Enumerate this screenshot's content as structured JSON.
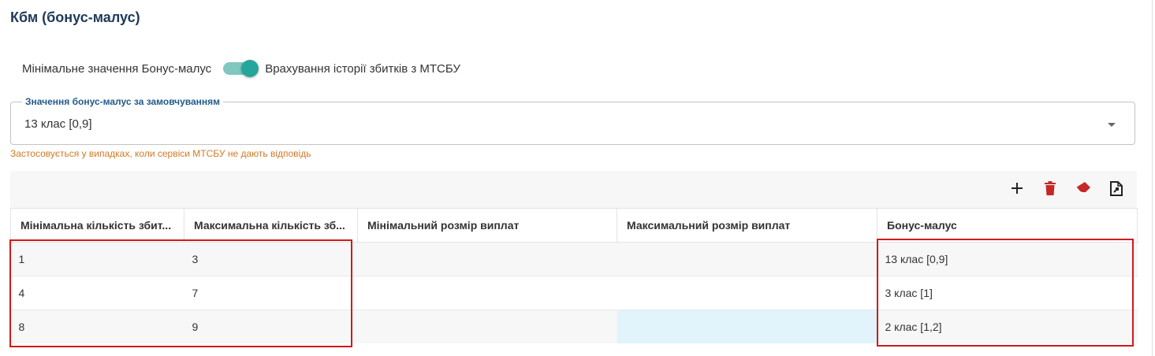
{
  "title": "Кбм (бонус-малус)",
  "switch": {
    "label_left": "Мінімальне значення Бонус-малус",
    "label_right": "Врахування історії збитків з МТСБУ",
    "state": "on",
    "accent_color": "#26a69a"
  },
  "default_select": {
    "label": "Значення бонус-малус за замовчуванням",
    "value": "13 клас [0,9]",
    "icon": "chevron-down-icon"
  },
  "helper_text": "Застосовується у випадках, коли сервіси МТСБУ не дають відповідь",
  "toolbar": {
    "icons": [
      "plus-icon",
      "trash-icon",
      "eraser-icon",
      "export-icon"
    ],
    "delete_color": "#c62828"
  },
  "table": {
    "columns": [
      "Мінімальна кількість збит...",
      "Максимальна кількість зб...",
      "Мінімальний розмір виплат",
      "Максимальний розмір виплат",
      "Бонус-малус"
    ],
    "rows": [
      [
        "1",
        "3",
        "",
        "",
        "13 клас [0,9]"
      ],
      [
        "4",
        "7",
        "",
        "",
        "3 клас [1]"
      ],
      [
        "8",
        "9",
        "",
        "",
        "2 клас [1,2]"
      ]
    ]
  },
  "highlight_color": "#d11a1a"
}
